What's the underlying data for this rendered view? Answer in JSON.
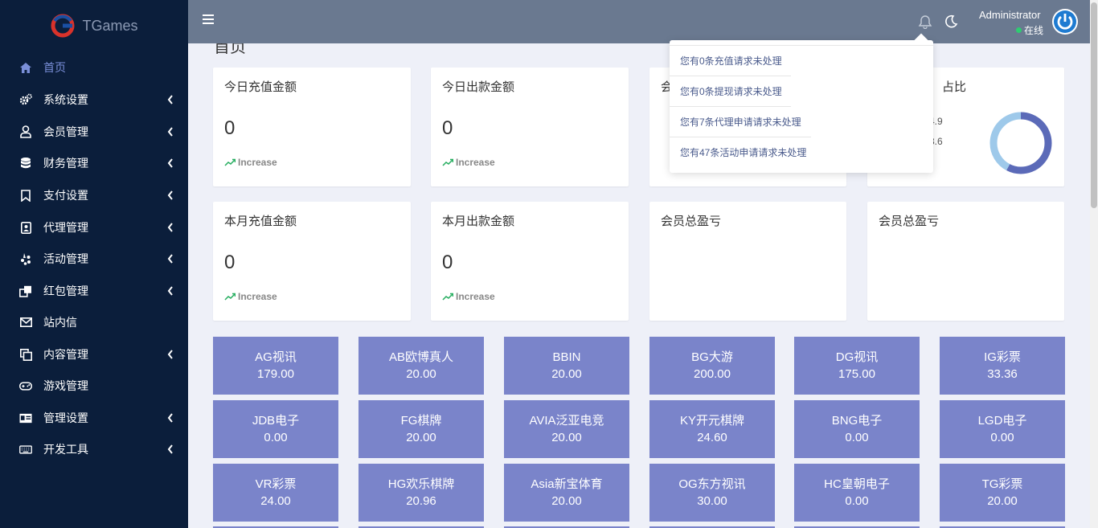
{
  "brand": {
    "name": "TGames"
  },
  "sidebar": {
    "items": [
      {
        "label": "首页",
        "icon": "home-icon",
        "active": true,
        "has_children": false
      },
      {
        "label": "系统设置",
        "icon": "cogs-icon",
        "has_children": true
      },
      {
        "label": "会员管理",
        "icon": "user-icon",
        "has_children": true
      },
      {
        "label": "财务管理",
        "icon": "database-icon",
        "has_children": true
      },
      {
        "label": "支付设置",
        "icon": "bookmark-icon",
        "has_children": true
      },
      {
        "label": "代理管理",
        "icon": "contact-icon",
        "has_children": true
      },
      {
        "label": "活动管理",
        "icon": "yelp-icon",
        "has_children": true
      },
      {
        "label": "红包管理",
        "icon": "clone-icon",
        "has_children": true
      },
      {
        "label": "站内信",
        "icon": "envelope-icon",
        "has_children": false
      },
      {
        "label": "内容管理",
        "icon": "copy-icon",
        "has_children": true
      },
      {
        "label": "游戏管理",
        "icon": "gamepad-icon",
        "has_children": false
      },
      {
        "label": "管理设置",
        "icon": "id-card-icon",
        "has_children": true
      },
      {
        "label": "开发工具",
        "icon": "keyboard-icon",
        "has_children": true
      }
    ]
  },
  "header": {
    "admin_name": "Administrator",
    "status": "在线"
  },
  "page": {
    "title": "首页"
  },
  "stats": {
    "row1": [
      {
        "title": "今日充值金额",
        "value": "0",
        "trend": "Increase"
      },
      {
        "title": "今日出款金额",
        "value": "0",
        "trend": "Increase"
      },
      {
        "title": "会",
        "value": "",
        "trend": ""
      },
      {
        "title": "占比",
        "value": "",
        "trend": ""
      }
    ],
    "row2": [
      {
        "title": "本月充值金额",
        "value": "0",
        "trend": "Increase"
      },
      {
        "title": "本月出款金额",
        "value": "0",
        "trend": "Increase"
      },
      {
        "title": "会员总盈亏",
        "value": "",
        "trend": ""
      },
      {
        "title": "会员总盈亏",
        "value": "",
        "trend": ""
      }
    ],
    "donut_legend": [
      "4.9",
      "3.6"
    ],
    "donut_colors": [
      "#5b6ab8",
      "#9ec9ea"
    ],
    "donut_values": [
      4.9,
      3.6
    ]
  },
  "notifications": [
    "您有0条充值请求未处理",
    "您有0条提现请求未处理",
    "您有7条代理申请请求未处理",
    "您有47条活动申请请求未处理"
  ],
  "games": [
    {
      "name": "AG视讯",
      "amount": "179.00"
    },
    {
      "name": "AB欧博真人",
      "amount": "20.00"
    },
    {
      "name": "BBIN",
      "amount": "20.00"
    },
    {
      "name": "BG大游",
      "amount": "200.00"
    },
    {
      "name": "DG视讯",
      "amount": "175.00"
    },
    {
      "name": "IG彩票",
      "amount": "33.36"
    },
    {
      "name": "JDB电子",
      "amount": "0.00"
    },
    {
      "name": "FG棋牌",
      "amount": "20.00"
    },
    {
      "name": "AVIA泛亚电竞",
      "amount": "20.00"
    },
    {
      "name": "KY开元棋牌",
      "amount": "24.60"
    },
    {
      "name": "BNG电子",
      "amount": "0.00"
    },
    {
      "name": "LGD电子",
      "amount": "0.00"
    },
    {
      "name": "VR彩票",
      "amount": "24.00"
    },
    {
      "name": "HG欢乐棋牌",
      "amount": "20.96"
    },
    {
      "name": "Asia新宝体育",
      "amount": "20.00"
    },
    {
      "name": "OG东方视讯",
      "amount": "30.00"
    },
    {
      "name": "HC皇朝电子",
      "amount": "0.00"
    },
    {
      "name": "TG彩票",
      "amount": "20.00"
    }
  ],
  "colors": {
    "sidebar_bg": "#0b1e3b",
    "topbar_bg": "#6a7990",
    "tile_bg": "#7a84ca",
    "active_nav": "#7a8fd8"
  }
}
